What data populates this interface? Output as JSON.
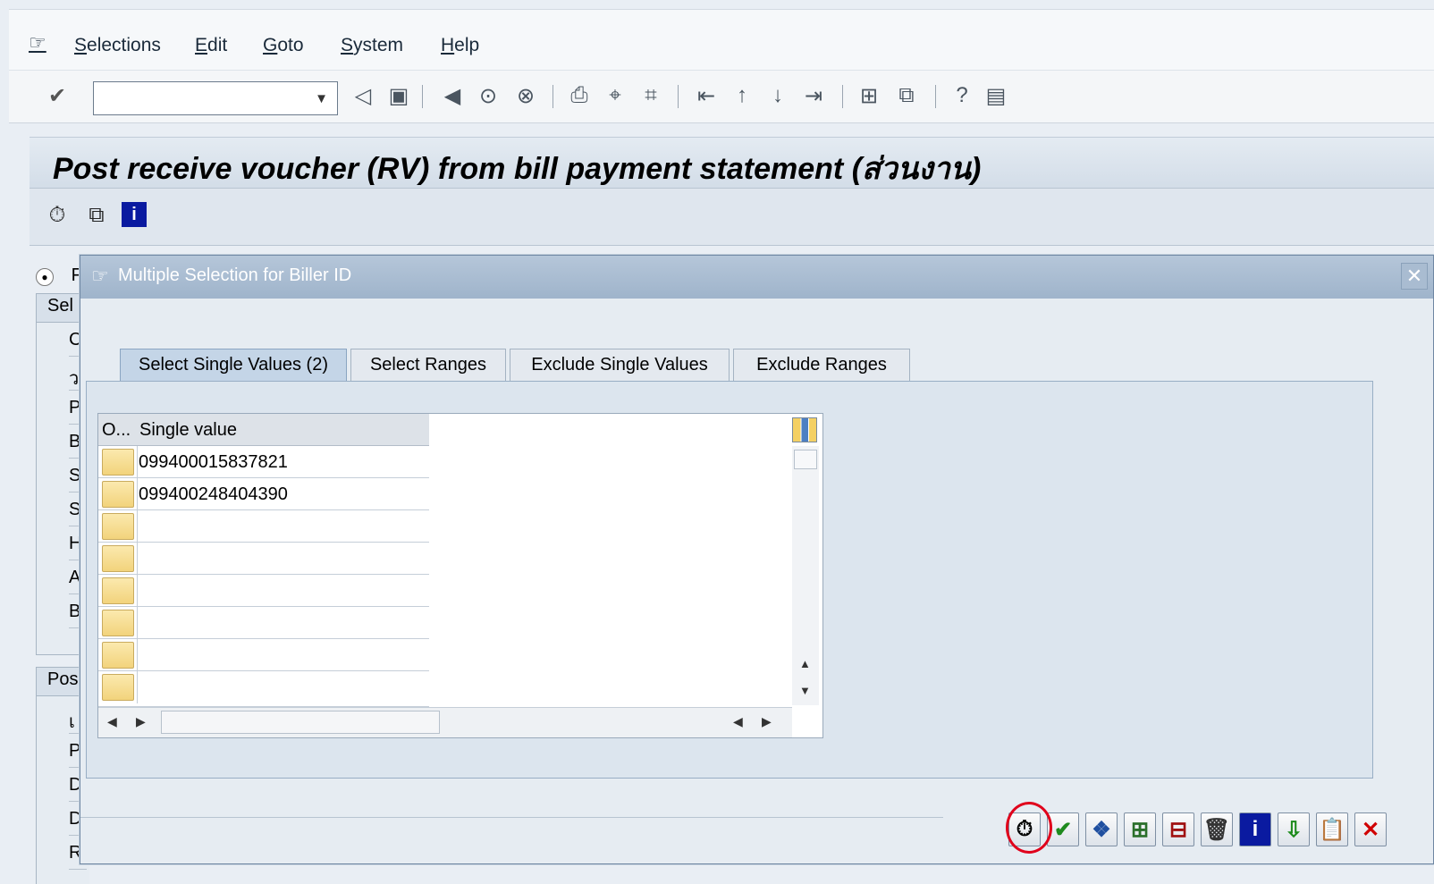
{
  "menu": {
    "items": [
      "Selections",
      "Edit",
      "Goto",
      "System",
      "Help"
    ],
    "icon": "menu-entry-icon"
  },
  "toolbar": {
    "command_field_value": "",
    "icons": [
      "enter-icon",
      "back-icon",
      "save-icon",
      "back-green-icon",
      "exit-icon",
      "cancel-icon",
      "print-icon",
      "find-icon",
      "find-next-icon",
      "first-page-icon",
      "previous-page-icon",
      "next-page-icon",
      "last-page-icon",
      "new-session-icon",
      "shortcut-icon",
      "help-icon",
      "layout-menu-icon"
    ]
  },
  "screen": {
    "title": "Post receive voucher (RV) from bill payment statement (ส่วนงาน)",
    "app_icons": [
      "execute-icon",
      "copy-variant-icon",
      "info-icon"
    ]
  },
  "background": {
    "radio_label_fragment": "F",
    "frame1_header": "Sel",
    "frame1_rows": [
      "C",
      "ว",
      "P",
      "B",
      "S",
      "S",
      "H",
      "A",
      "B"
    ],
    "frame2_header": "Pos",
    "frame2_rows": [
      "เ",
      "P",
      "D",
      "D",
      "R"
    ]
  },
  "dialog": {
    "title": "Multiple Selection for Biller ID",
    "close": "✕",
    "tabs": [
      {
        "label": "Select Single Values (2)",
        "active": true
      },
      {
        "label": "Select Ranges",
        "active": false
      },
      {
        "label": "Exclude Single Values",
        "active": false
      },
      {
        "label": "Exclude Ranges",
        "active": false
      }
    ],
    "grid": {
      "col_option": "O...",
      "col_value": "Single value",
      "rows": [
        "099400015837821",
        "099400248404390",
        "",
        "",
        "",
        "",
        "",
        ""
      ]
    },
    "buttons": [
      "execute-button",
      "check-entries-button",
      "multiple-selection-button",
      "insert-line-button",
      "delete-line-button",
      "delete-all-button",
      "help-button",
      "import-text-button",
      "upload-clipboard-button",
      "cancel-button"
    ]
  },
  "colors": {
    "highlight": "#e0001b",
    "dialog_title_bg": "#a9bcd1"
  }
}
